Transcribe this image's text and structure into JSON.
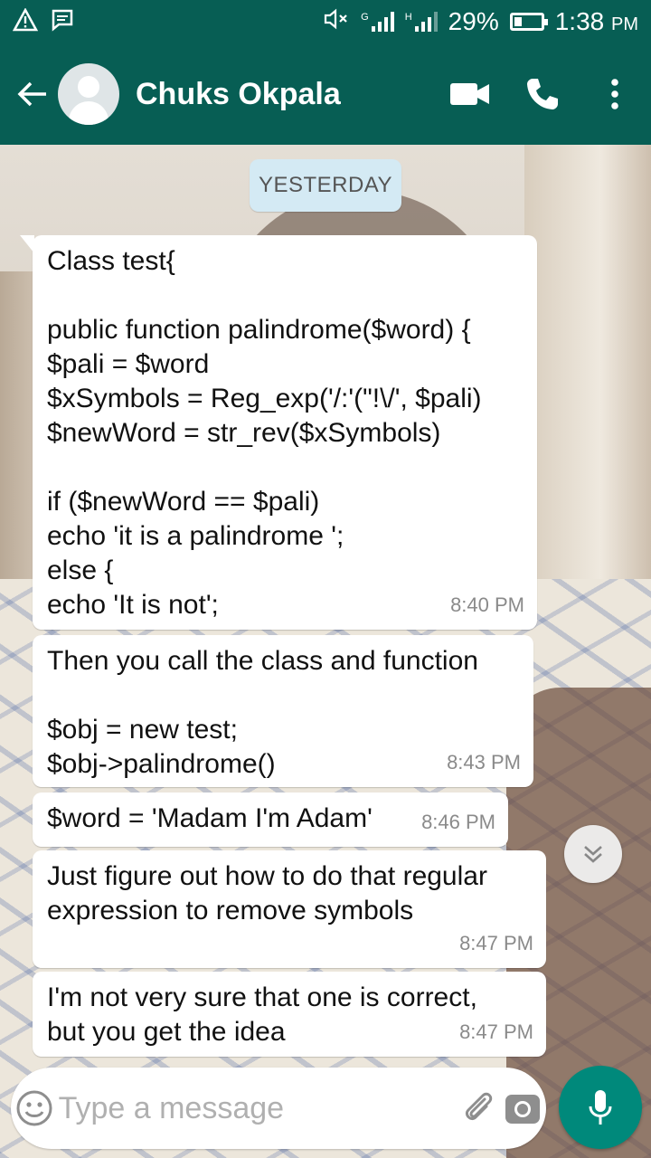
{
  "status_bar": {
    "battery": "29%",
    "time": "1:38",
    "ampm": "PM",
    "sim1_label": "G",
    "sim2_label": "H"
  },
  "toolbar": {
    "contact_name": "Chuks Okpala"
  },
  "chat": {
    "date_chip": "YESTERDAY",
    "messages": [
      {
        "text": "Class test{\n\npublic function palindrome($word) {\n$pali = $word\n$xSymbols = Reg_exp('/:'(\"!\\/', $pali)\n$newWord = str_rev($xSymbols)\n\nif ($newWord == $pali)\necho 'it is a palindrome ';\nelse {\necho 'It is not';",
        "time": "8:40 PM"
      },
      {
        "text": "Then you call the class and function\n\n$obj = new test;\n$obj->palindrome()",
        "time": "8:43 PM"
      },
      {
        "text": "$word = 'Madam I'm Adam'",
        "time": "8:46 PM"
      },
      {
        "text": "Just figure out how to do that regular\nexpression to remove symbols",
        "time": "8:47 PM"
      },
      {
        "text": "I'm not very sure that one is correct,\nbut you get the idea",
        "time": "8:47 PM"
      }
    ]
  },
  "input": {
    "placeholder": "Type a message"
  },
  "colors": {
    "header": "#075e54",
    "mic_button": "#00897b",
    "date_chip": "#d4eaf4",
    "bubble": "#ffffff"
  },
  "icons": [
    "warning-icon",
    "message-icon",
    "mute-icon",
    "signal-icon",
    "battery-icon",
    "back-arrow-icon",
    "video-call-icon",
    "phone-icon",
    "more-vert-icon",
    "scroll-down-icon",
    "emoji-icon",
    "attach-icon",
    "camera-icon",
    "mic-icon"
  ]
}
